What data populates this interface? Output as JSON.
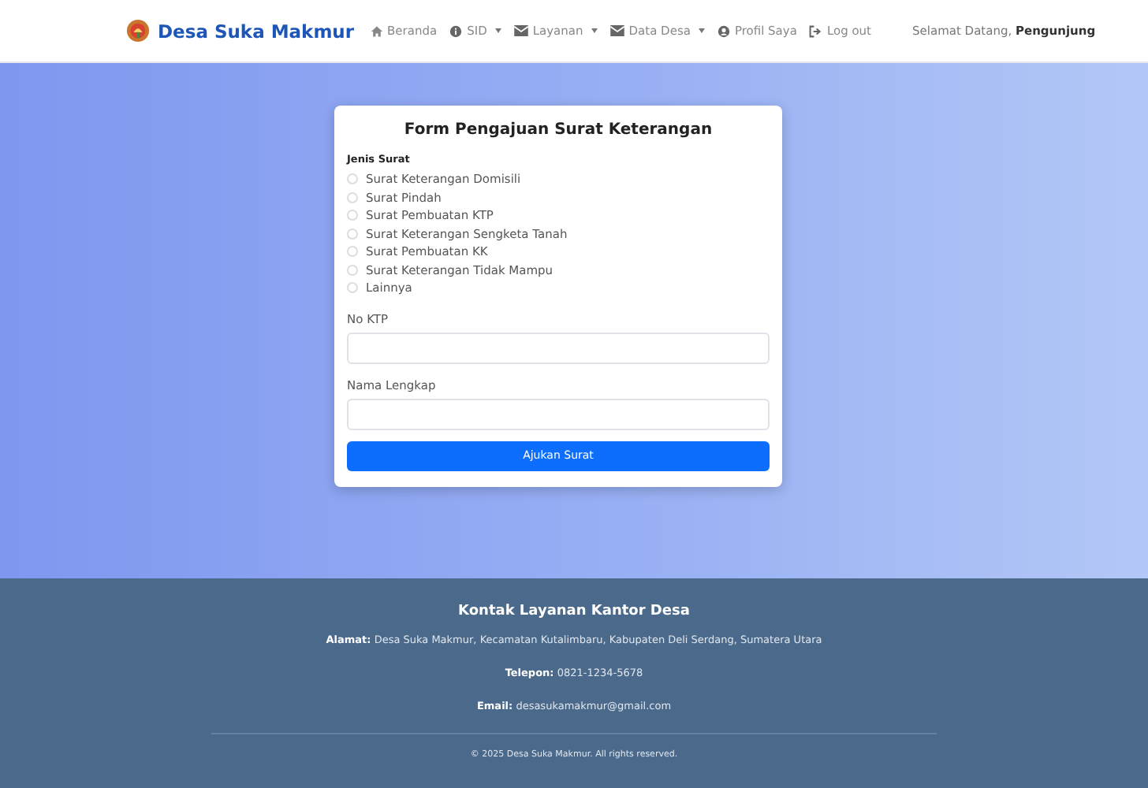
{
  "navbar": {
    "brand": "Desa Suka Makmur",
    "items": [
      {
        "label": "Beranda",
        "dropdown": false
      },
      {
        "label": "SID",
        "dropdown": true
      },
      {
        "label": "Layanan",
        "dropdown": true
      },
      {
        "label": "Data Desa",
        "dropdown": true
      },
      {
        "label": "Profil Saya",
        "dropdown": false
      },
      {
        "label": "Log out",
        "dropdown": false
      }
    ],
    "greeting": "Selamat Datang, **Pengunjung**"
  },
  "form": {
    "title": "Form Pengajuan Surat Keterangan",
    "group_label": "Jenis Surat",
    "options": [
      {
        "label": "Surat Keterangan Domisili",
        "selected": false
      },
      {
        "label": "Surat Pindah",
        "selected": false
      },
      {
        "label": "Surat Pembuatan KTP",
        "selected": false
      },
      {
        "label": "Surat Keterangan Sengketa Tanah",
        "selected": false
      },
      {
        "label": "Surat Pembuatan KK",
        "selected": false
      },
      {
        "label": "Surat Keterangan Tidak Mampu",
        "selected": false
      },
      {
        "label": "Lainnya",
        "selected": false
      }
    ],
    "fields": [
      {
        "label": "No KTP"
      },
      {
        "label": "Nama Lengkap"
      }
    ],
    "submit": "Ajukan Surat"
  },
  "footer": {
    "title": "Kontak Layanan Kantor Desa",
    "lines": [
      "**Alamat:** Desa Suka Makmur, Kecamatan Kutalimbaru, Kabupaten Deli Serdang, Sumatera Utara",
      "**Telepon:** 0821-1234-5678",
      "**Email:** desasukamakmur@gmail.com"
    ],
    "copyright": "© 2025 Desa Suka Makmur. All rights reserved."
  }
}
